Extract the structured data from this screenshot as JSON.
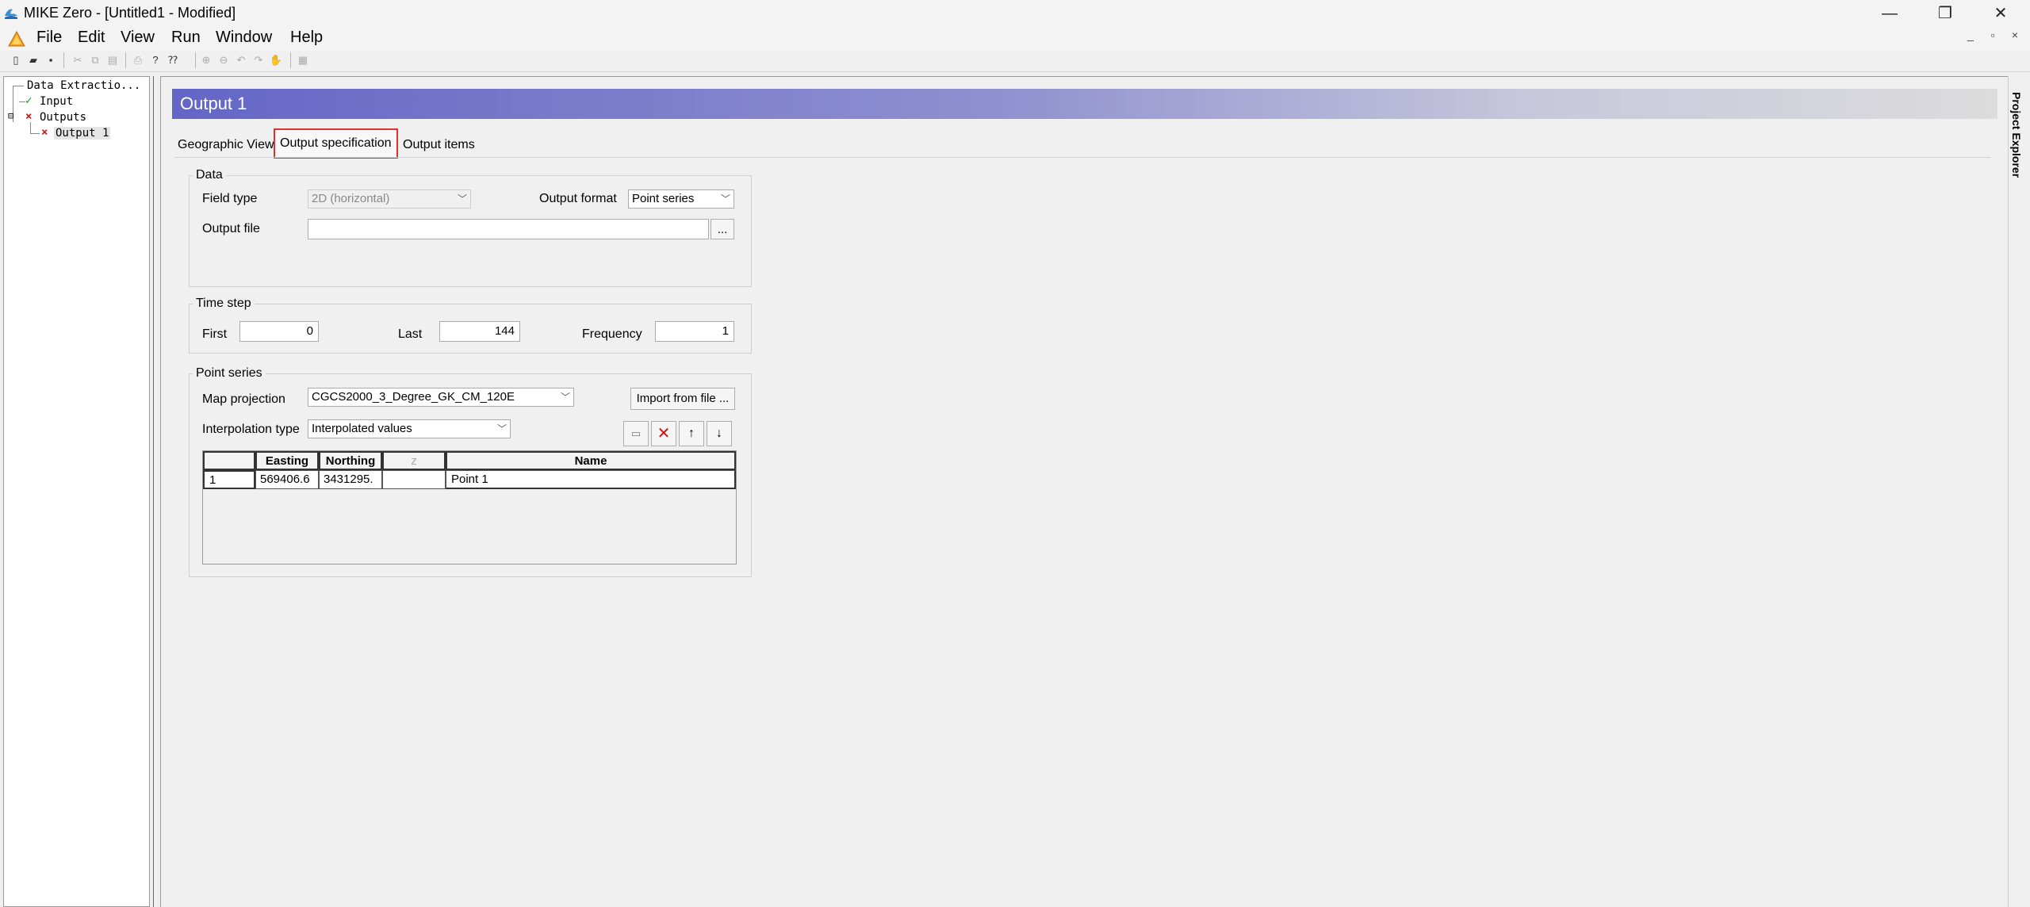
{
  "window": {
    "title": "MIKE Zero - [Untitled1 - Modified]",
    "controls": {
      "minimize": "—",
      "restore": "❐",
      "close": "✕"
    }
  },
  "menu": {
    "items": [
      "File",
      "Edit",
      "View",
      "Run",
      "Window",
      "Help"
    ],
    "mdi_controls": {
      "minimize": "_",
      "restore": "▫",
      "close": "×"
    }
  },
  "tree": {
    "root": "Data Extractio...",
    "input": "Input",
    "outputs": "Outputs",
    "output1": "Output 1",
    "expander": "⊟"
  },
  "header": {
    "title": "Output 1"
  },
  "tabs": [
    "Geographic View",
    "Output specification",
    "Output items"
  ],
  "data_group": {
    "legend": "Data",
    "field_type_label": "Field type",
    "field_type_value": "2D (horizontal)",
    "output_format_label": "Output format",
    "output_format_value": "Point series",
    "output_file_label": "Output file",
    "output_file_value": "",
    "browse_label": "..."
  },
  "time_step_group": {
    "legend": "Time step",
    "first_label": "First",
    "first_value": "0",
    "last_label": "Last",
    "last_value": "144",
    "frequency_label": "Frequency",
    "frequency_value": "1"
  },
  "point_series_group": {
    "legend": "Point series",
    "map_projection_label": "Map projection",
    "map_projection_value": "CGCS2000_3_Degree_GK_CM_120E",
    "import_button": "Import from file ...",
    "interpolation_label": "Interpolation type",
    "interpolation_value": "Interpolated values",
    "grid": {
      "headers": [
        "",
        "Easting",
        "Northing",
        "z",
        "Name"
      ],
      "rows": [
        [
          "1",
          "569406.6",
          "3431295.",
          "",
          "Point 1"
        ]
      ]
    }
  },
  "right_strip": {
    "label": "Project Explorer"
  }
}
